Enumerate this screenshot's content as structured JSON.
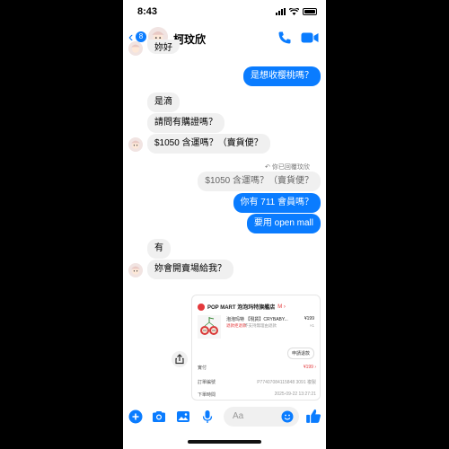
{
  "status_bar": {
    "time": "8:43"
  },
  "header": {
    "back_badge": "8",
    "contact_name": "柯玟欣"
  },
  "messages": {
    "partial_top": "妳好",
    "m1_out": "是想收樱桃嗎？",
    "m2_in": "是滴",
    "m3_in": "請問有購證嗎？",
    "m4_in": "$1050 含運嗎？（賣貨便？",
    "reply_note": "你已回覆玟欣",
    "quoted": "$1050 含運嗎？（賣貨便？",
    "m5_out": "你有 711 會員嗎？",
    "m6_out": "要用 open mall",
    "m7_in": "有",
    "m8_in": "妳會開賣場給我？"
  },
  "order_card": {
    "shop_name": "POP MART 泡泡玛特旗艦店",
    "shop_tag": "M ›",
    "product_title": "泡泡玛特 【現貨】CRYBABY...",
    "product_price": "¥199",
    "product_tag": "退款拒退款",
    "product_sub": "不支持無理由退款",
    "product_qty": "×1",
    "refund_button": "申請退款",
    "rows": [
      {
        "label": "實付",
        "value": "¥199 ›"
      },
      {
        "label": "訂單編號",
        "value": "P77407084115848 3091  複製"
      },
      {
        "label": "下單時間",
        "value": "2025-09-22 13:27:21"
      }
    ]
  },
  "composer": {
    "placeholder": "Aa"
  },
  "colors": {
    "accent": "#0a7cff",
    "incoming": "#f0f0f0",
    "price_red": "#e4393c"
  },
  "icons": [
    "back-chevron-icon",
    "phone-icon",
    "video-icon",
    "share-icon",
    "plus-icon",
    "camera-icon",
    "image-icon",
    "mic-icon",
    "emoji-icon",
    "thumbs-up-icon"
  ]
}
